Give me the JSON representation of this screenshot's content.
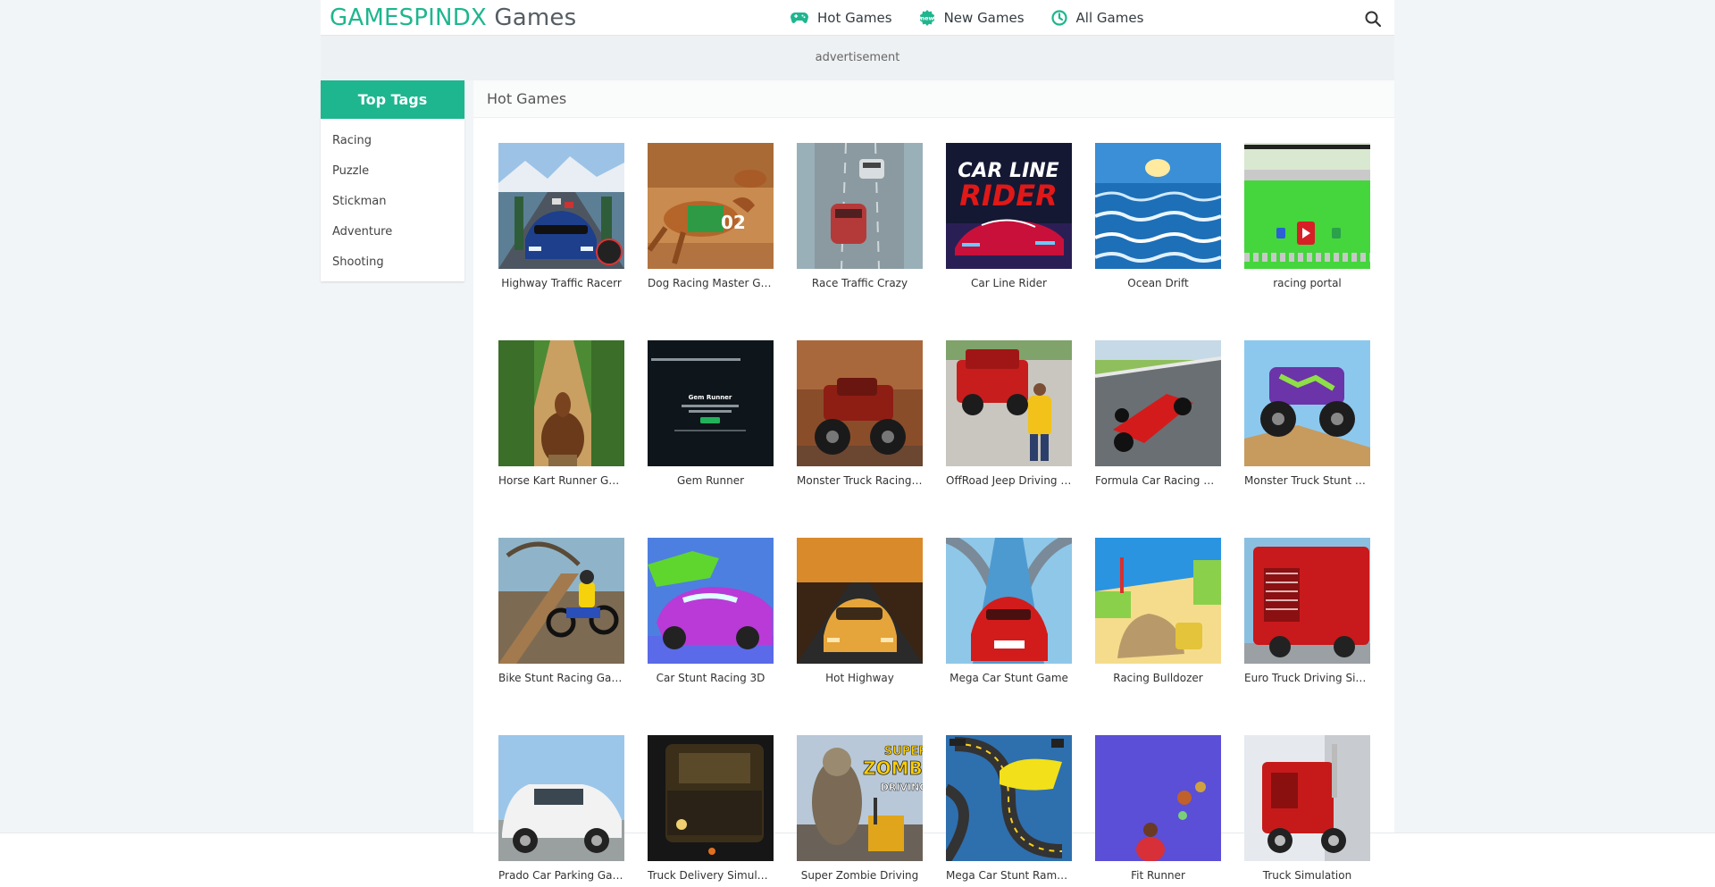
{
  "header": {
    "logo_brand": "GAMESPINDX",
    "logo_suffix": "Games",
    "nav": [
      {
        "label": "Hot Games",
        "icon": "gamepad-icon"
      },
      {
        "label": "New Games",
        "icon": "new-badge-icon"
      },
      {
        "label": "All Games",
        "icon": "clock-icon"
      }
    ],
    "search_icon": "search-icon"
  },
  "ad_label": "advertisement",
  "sidebar": {
    "title": "Top Tags",
    "tags": [
      "Racing",
      "Puzzle",
      "Stickman",
      "Adventure",
      "Shooting"
    ]
  },
  "main": {
    "title": "Hot Games",
    "games": [
      {
        "title": "Highway Traffic Racerr"
      },
      {
        "title": "Dog Racing Master Game"
      },
      {
        "title": "Race Traffic Crazy"
      },
      {
        "title": "Car Line Rider",
        "art_text": [
          "CAR LINE",
          "RIDER"
        ]
      },
      {
        "title": "Ocean Drift"
      },
      {
        "title": "racing portal"
      },
      {
        "title": "Horse Kart Runner Game"
      },
      {
        "title": "Gem Runner",
        "art_text": [
          "Gem Runner"
        ]
      },
      {
        "title": "Monster Truck Racing G..."
      },
      {
        "title": "OffRoad Jeep Driving G..."
      },
      {
        "title": "Formula Car Racing Ga..."
      },
      {
        "title": "Monster Truck Stunt Ga..."
      },
      {
        "title": "Bike Stunt Racing Game"
      },
      {
        "title": "Car Stunt Racing 3D"
      },
      {
        "title": "Hot Highway"
      },
      {
        "title": "Mega Car Stunt Game"
      },
      {
        "title": "Racing Bulldozer"
      },
      {
        "title": "Euro Truck Driving Simul..."
      },
      {
        "title": "Prado Car Parking Game"
      },
      {
        "title": "Truck Delivery Simulator"
      },
      {
        "title": "Super Zombie Driving",
        "art_text": [
          "SUPER",
          "ZOMBIE",
          "DRIVING"
        ]
      },
      {
        "title": "Mega Car Stunt Ramps ..."
      },
      {
        "title": "Fit Runner"
      },
      {
        "title": "Truck Simulation"
      }
    ]
  },
  "colors": {
    "accent": "#1eb68f"
  }
}
